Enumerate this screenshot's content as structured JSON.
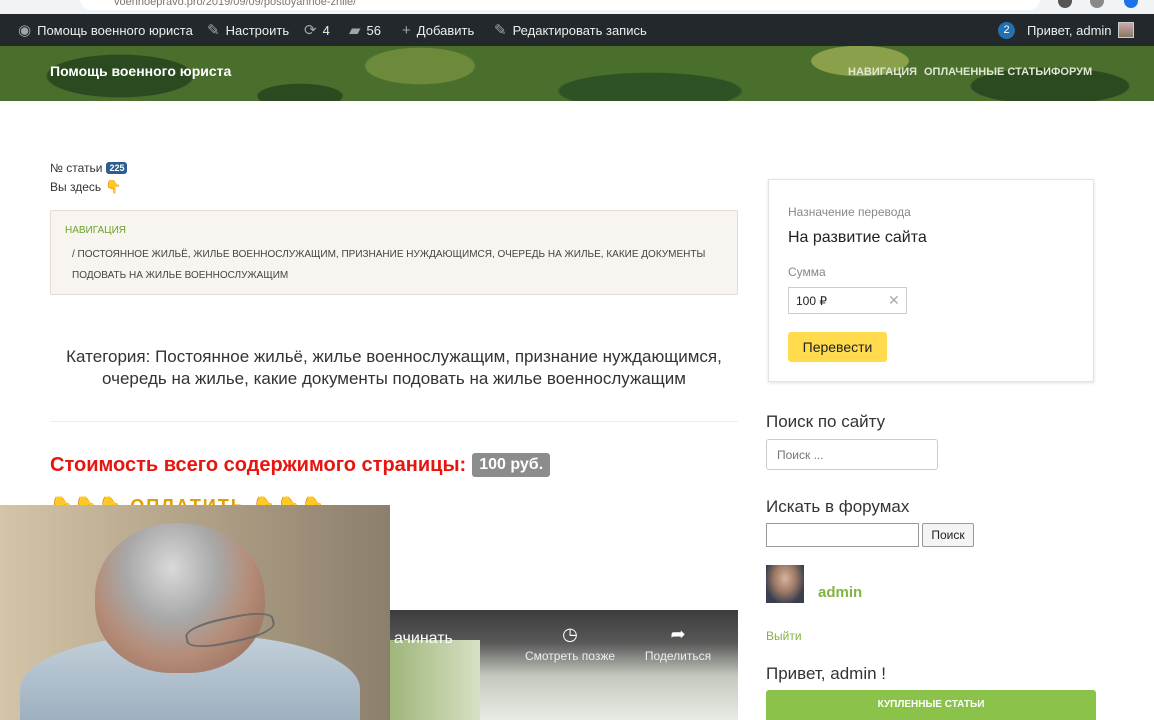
{
  "browser": {
    "url": "voennoepravo.pro/2019/09/09/postoyannoe-zhile/"
  },
  "admin_bar": {
    "site_name": "Помощь военного юриста",
    "customize": "Настроить",
    "updates_count": "4",
    "comments_count": "56",
    "add_new": "Добавить",
    "edit_post": "Редактировать запись",
    "notifications_count": "2",
    "greeting": "Привет, admin"
  },
  "header": {
    "site_title": "Помощь военного юриста",
    "nav": [
      "НАВИГАЦИЯ",
      "ОПЛАЧЕННЫЕ СТАТЬИ",
      "ФОРУМ"
    ]
  },
  "article": {
    "number_label": "№ статьи",
    "number_value": "225",
    "you_are_here": "Вы здесь",
    "breadcrumb_nav": "НАВИГАЦИЯ",
    "breadcrumb_current": "/   ПОСТОЯННОЕ ЖИЛЬЁ, ЖИЛЬЕ ВОЕННОСЛУЖАЩИМ, ПРИЗНАНИЕ НУЖДАЮЩИМСЯ, ОЧЕРЕДЬ НА ЖИЛЬЕ, КАКИЕ ДОКУМЕНТЫ ПОДОВАТЬ НА ЖИЛЬЕ ВОЕННОСЛУЖАЩИМ",
    "category": "Категория: Постоянное жильё, жилье военнослужащим, признание нуждающимся, очередь на жилье, какие документы подовать на жилье военнослужащим",
    "cost_label": "Стоимость всего содержимого страницы:",
    "cost_value": "100 руб.",
    "emoji_row": "👇👇👇 ОПЛАТИТЬ 👇👇👇"
  },
  "video": {
    "partial_text": "ачинать",
    "watch_later": "Смотреть позже",
    "share": "Поделиться"
  },
  "sidebar": {
    "donate": {
      "purpose_label": "Назначение перевода",
      "purpose_value": "На развитие сайта",
      "amount_label": "Сумма",
      "amount_value": "100 ₽",
      "submit": "Перевести"
    },
    "search_title": "Поиск по сайту",
    "search_placeholder": "Поиск ...",
    "forum_title": "Искать в форумах",
    "forum_button": "Поиск",
    "user_name": "admin",
    "logout": "Выйти",
    "hello": "Привет, admin !",
    "bought_button": "КУПЛЕННЫЕ СТАТЬИ"
  },
  "colors": {
    "admin_bar": "#23282d",
    "accent_green": "#82b440",
    "cost_red": "#e8150f",
    "donate_yellow": "#ffdb4d"
  }
}
